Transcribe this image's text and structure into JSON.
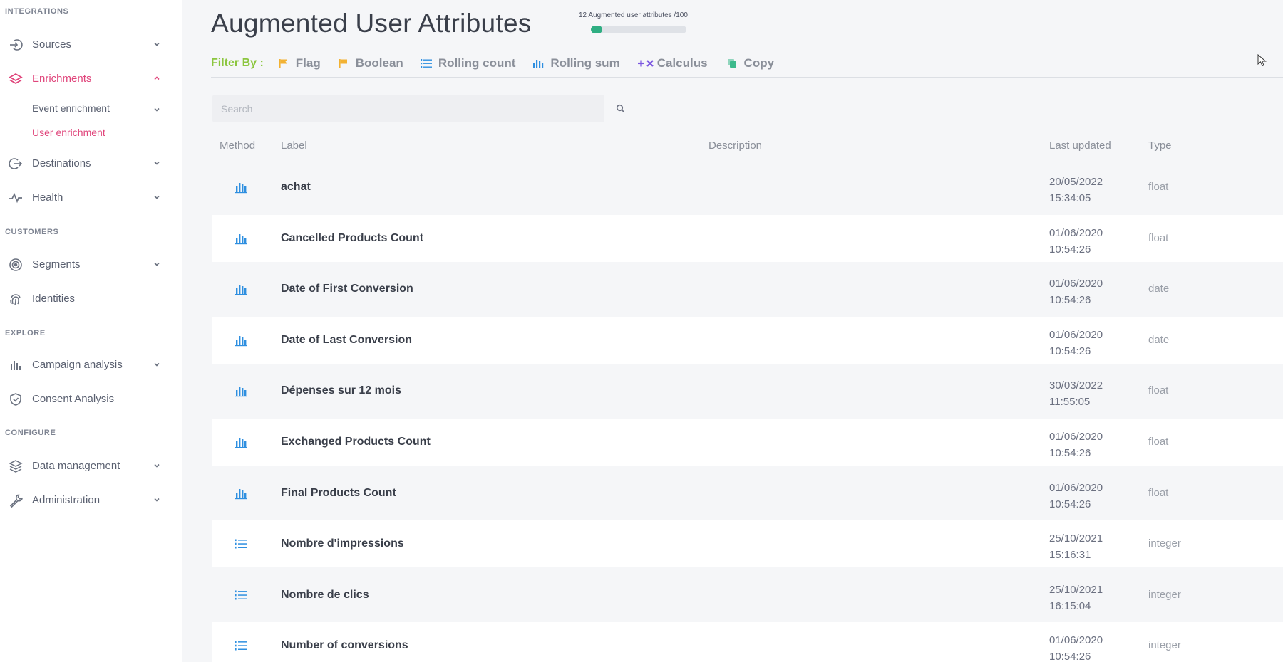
{
  "sidebar": {
    "sections": {
      "integrations": "INTEGRATIONS",
      "customers": "CUSTOMERS",
      "explore": "EXPLORE",
      "configure": "CONFIGURE"
    },
    "items": {
      "sources": "Sources",
      "enrichments": "Enrichments",
      "event_enrichment": "Event enrichment",
      "user_enrichment": "User enrichment",
      "destinations": "Destinations",
      "health": "Health",
      "segments": "Segments",
      "identities": "Identities",
      "campaign_analysis": "Campaign analysis",
      "consent_analysis": "Consent Analysis",
      "data_management": "Data management",
      "administration": "Administration"
    },
    "active_color": "#e0457b"
  },
  "header": {
    "title": "Augmented User Attributes",
    "quota_text": "12 Augmented user attributes /100",
    "quota_fraction": 0.12
  },
  "filters": {
    "label": "Filter By :",
    "items": [
      "Flag",
      "Boolean",
      "Rolling count",
      "Rolling sum",
      "Calculus",
      "Copy"
    ]
  },
  "search": {
    "placeholder": "Search",
    "value": ""
  },
  "table": {
    "headers": {
      "method": "Method",
      "label": "Label",
      "description": "Description",
      "last_updated": "Last updated",
      "type": "Type"
    },
    "rows": [
      {
        "method": "rolling-sum",
        "label": "achat",
        "description": "",
        "date": "20/05/2022",
        "time": "15:34:05",
        "type": "float"
      },
      {
        "method": "rolling-sum",
        "label": "Cancelled Products Count",
        "description": "",
        "date": "01/06/2020",
        "time": "10:54:26",
        "type": "float"
      },
      {
        "method": "rolling-sum",
        "label": "Date of First Conversion",
        "description": "",
        "date": "01/06/2020",
        "time": "10:54:26",
        "type": "date"
      },
      {
        "method": "rolling-sum",
        "label": "Date of Last Conversion",
        "description": "",
        "date": "01/06/2020",
        "time": "10:54:26",
        "type": "date"
      },
      {
        "method": "rolling-sum",
        "label": "Dépenses sur 12 mois",
        "description": "",
        "date": "30/03/2022",
        "time": "11:55:05",
        "type": "float"
      },
      {
        "method": "rolling-sum",
        "label": "Exchanged Products Count",
        "description": "",
        "date": "01/06/2020",
        "time": "10:54:26",
        "type": "float"
      },
      {
        "method": "rolling-sum",
        "label": "Final Products Count",
        "description": "",
        "date": "01/06/2020",
        "time": "10:54:26",
        "type": "float"
      },
      {
        "method": "rolling-count",
        "label": "Nombre d'impressions",
        "description": "",
        "date": "25/10/2021",
        "time": "15:16:31",
        "type": "integer"
      },
      {
        "method": "rolling-count",
        "label": "Nombre de clics",
        "description": "",
        "date": "25/10/2021",
        "time": "16:15:04",
        "type": "integer"
      },
      {
        "method": "rolling-count",
        "label": "Number of conversions",
        "description": "",
        "date": "01/06/2020",
        "time": "10:54:26",
        "type": "integer"
      }
    ]
  },
  "colors": {
    "filter_label": "#8cc63f",
    "flag": "#f2b233",
    "method_icon": "#2e8fe0",
    "calculus": "#7b57e0",
    "copy": "#3cba8c",
    "quota_fill": "#2fae82"
  }
}
